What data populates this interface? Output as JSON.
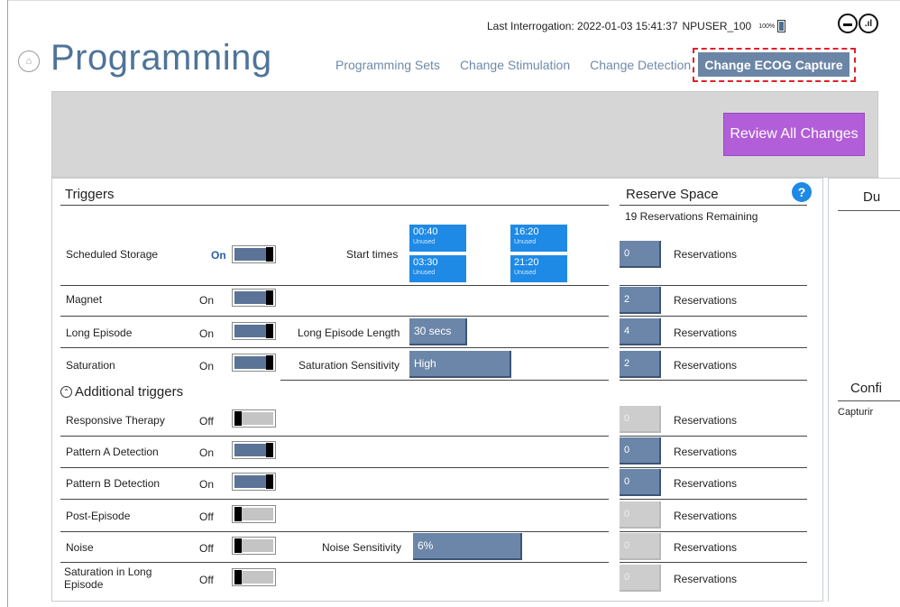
{
  "status_bar": {
    "last_interrogation": "Last Interrogation: 2022-01-03 15:41:37",
    "user": "NPUSER_100",
    "battery": "100%"
  },
  "header": {
    "title": "Programming",
    "tabs": [
      "Programming Sets",
      "Change Stimulation",
      "Change Detection",
      "Change ECOG Capture"
    ],
    "active_tab": "Change ECOG Capture"
  },
  "actions": {
    "review_all_changes": "Review All Changes"
  },
  "triggers": {
    "title": "Triggers",
    "scheduled_storage": {
      "label": "Scheduled Storage",
      "state": "On",
      "start_times_label": "Start times",
      "times": [
        {
          "time": "00:40",
          "status": "Unused"
        },
        {
          "time": "16:20",
          "status": "Unused"
        },
        {
          "time": "03:30",
          "status": "Unused"
        },
        {
          "time": "21:20",
          "status": "Unused"
        }
      ]
    },
    "magnet": {
      "label": "Magnet",
      "state": "On"
    },
    "long_episode": {
      "label": "Long Episode",
      "state": "On",
      "field_label": "Long Episode Length",
      "field_value": "30 secs"
    },
    "saturation": {
      "label": "Saturation",
      "state": "On",
      "field_label": "Saturation Sensitivity",
      "field_value": "High"
    }
  },
  "additional_triggers": {
    "title": "Additional triggers",
    "responsive_therapy": {
      "label": "Responsive Therapy",
      "state": "Off"
    },
    "pattern_a": {
      "label": "Pattern A Detection",
      "state": "On"
    },
    "pattern_b": {
      "label": "Pattern B Detection",
      "state": "On"
    },
    "post_episode": {
      "label": "Post-Episode",
      "state": "Off"
    },
    "noise": {
      "label": "Noise",
      "state": "Off",
      "field_label": "Noise Sensitivity",
      "field_value": "6%"
    },
    "saturation_long": {
      "label": "Saturation in Long Episode",
      "state": "Off"
    }
  },
  "reserve_space": {
    "title": "Reserve Space",
    "remaining": "19 Reservations Remaining",
    "label": "Reservations",
    "values": [
      "0",
      "2",
      "4",
      "2",
      "0",
      "0",
      "0",
      "0",
      "0",
      "0"
    ]
  },
  "side_panel": {
    "title_partial": "Du",
    "section_partial": "Confi",
    "text_partial": "Capturir"
  },
  "colors": {
    "accent": "#4f7499",
    "active_tab": "#6b85a6",
    "review_button": "#b25ed8",
    "time_button": "#1e8ae6",
    "highlight_border": "#e0202a"
  }
}
